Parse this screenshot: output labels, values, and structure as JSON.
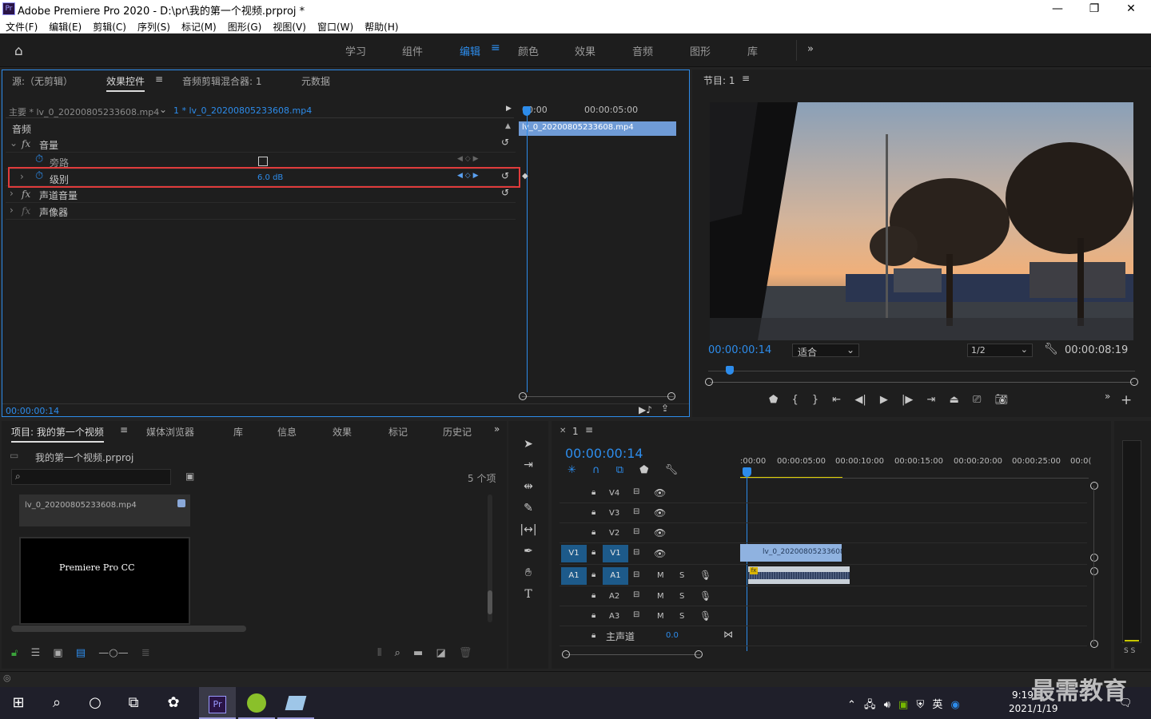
{
  "window": {
    "title": "Adobe Premiere Pro 2020 - D:\\pr\\我的第一个视频.prproj *",
    "app_icon": "Pr"
  },
  "menu": [
    "文件(F)",
    "编辑(E)",
    "剪辑(C)",
    "序列(S)",
    "标记(M)",
    "图形(G)",
    "视图(V)",
    "窗口(W)",
    "帮助(H)"
  ],
  "workspaces": [
    "学习",
    "组件",
    "编辑",
    "颜色",
    "效果",
    "音频",
    "图形",
    "库"
  ],
  "ec": {
    "tabs": [
      "源:（无剪辑）",
      "效果控件",
      "音频剪辑混合器: 1",
      "元数据"
    ],
    "master": "主要 * lv_0_20200805233608.mp4",
    "clip": "1 * lv_0_20200805233608.mp4",
    "section": "音频",
    "fx1": "音量",
    "bypass": "旁路",
    "level": "级别",
    "level_val": "6.0 dB",
    "fx2": "声道音量",
    "fx3": "声像器",
    "t0": "00:00",
    "t1": "00:00:05:00",
    "cliplabel": "lv_0_20200805233608.mp4",
    "tc": "00:00:00:14"
  },
  "program": {
    "title": "节目: 1",
    "tc_current": "00:00:00:14",
    "fit": "适合",
    "res": "1/2",
    "tc_total": "00:00:08:19"
  },
  "project": {
    "tabs": [
      "项目: 我的第一个视频",
      "媒体浏览器",
      "库",
      "信息",
      "效果",
      "标记",
      "历史记"
    ],
    "file": "我的第一个视频.prproj",
    "count": "5 个项",
    "item1": "lv_0_20200805233608.mp4",
    "item2": "Premiere Pro CC"
  },
  "timeline": {
    "seq": "1",
    "tc": "00:00:00:14",
    "ruler": [
      ":00:00",
      "00:00:05:00",
      "00:00:10:00",
      "00:00:15:00",
      "00:00:20:00",
      "00:00:25:00",
      "00:0("
    ],
    "video_tracks": [
      "V4",
      "V3",
      "V2",
      "V1"
    ],
    "audio_tracks": [
      "A1",
      "A2",
      "A3"
    ],
    "master": "主声道",
    "master_val": "0.0",
    "clip": "lv_0_20200805233608."
  },
  "meter": "S S",
  "taskbar": {
    "time": "9:19",
    "date": "2021/1/19",
    "ime": "英",
    "watermark": "最需教育"
  }
}
